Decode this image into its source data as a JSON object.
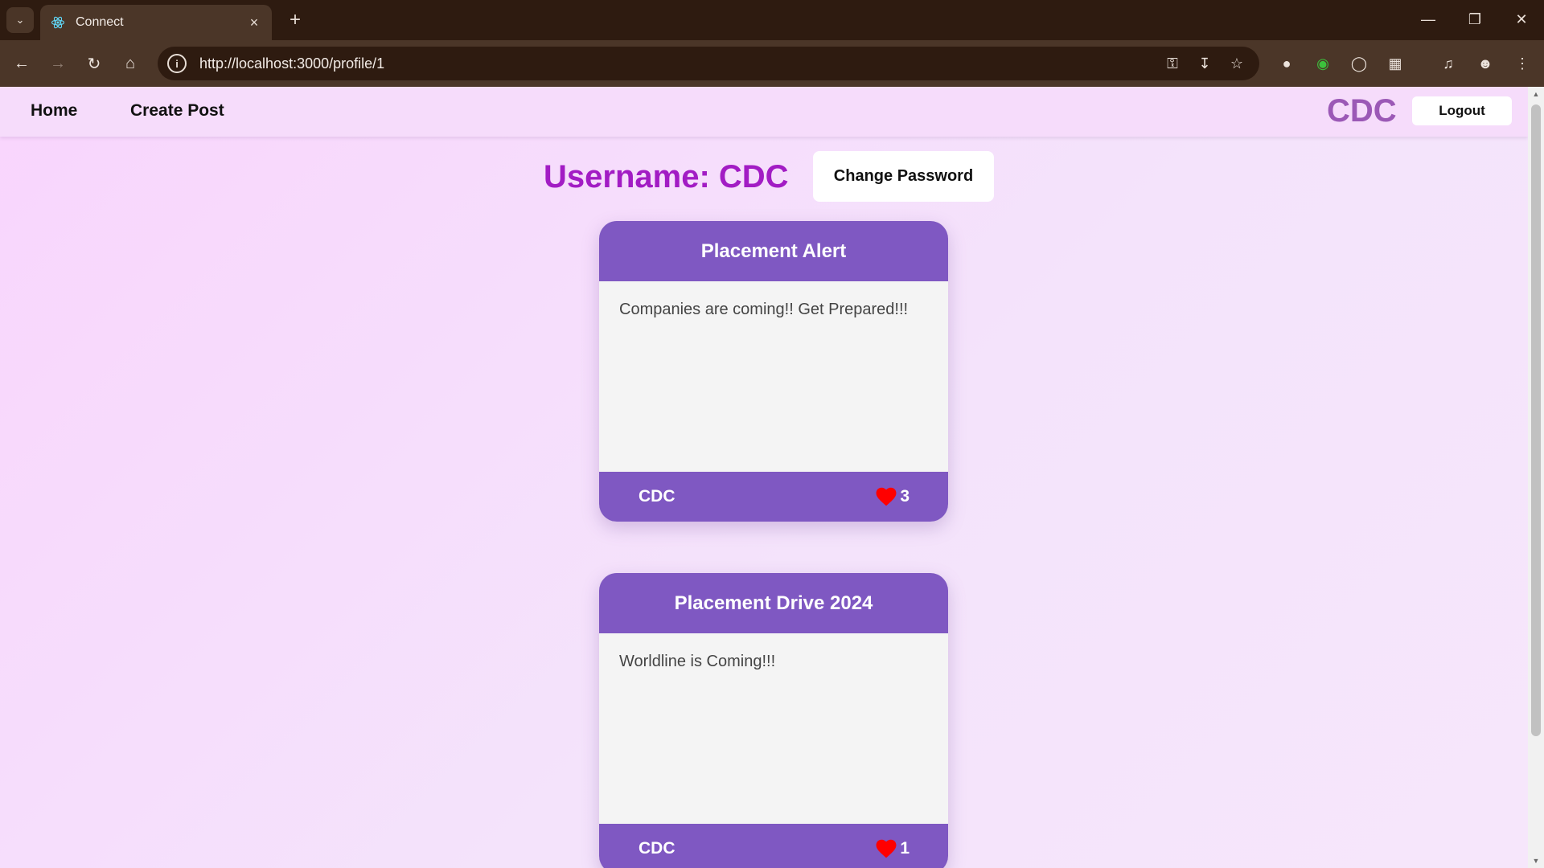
{
  "browser": {
    "tab_title": "Connect",
    "url": "http://localhost:3000/profile/1"
  },
  "navbar": {
    "home": "Home",
    "create_post": "Create Post",
    "brand": "CDC",
    "logout": "Logout"
  },
  "profile": {
    "username_label": "Username: CDC",
    "change_password": "Change Password"
  },
  "posts": [
    {
      "title": "Placement Alert",
      "body": "Companies are coming!! Get Prepared!!!",
      "author": "CDC",
      "likes": "3"
    },
    {
      "title": "Placement Drive 2024",
      "body": "Worldline is Coming!!!",
      "author": "CDC",
      "likes": "1"
    }
  ],
  "colors": {
    "accent": "#7f58c2",
    "username": "#a21cc4",
    "brand": "#9b59b6",
    "heart": "#ff0000"
  }
}
